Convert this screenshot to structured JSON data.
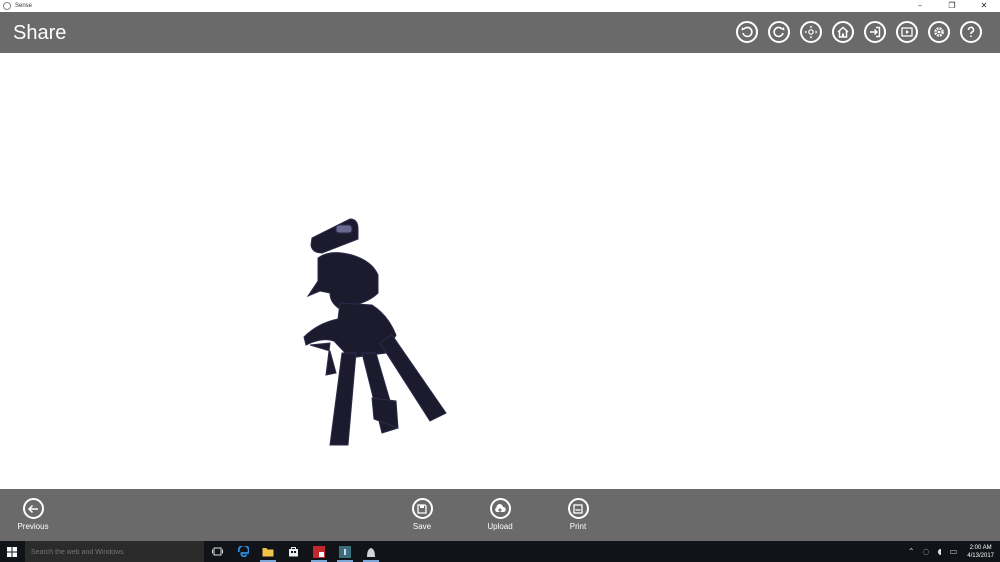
{
  "window": {
    "title": "Sense",
    "controls": [
      "–",
      "❐",
      "✕"
    ]
  },
  "header": {
    "title": "Share",
    "toolbar": [
      {
        "icon": "rotate-left-icon",
        "name": "undo-rotate-button"
      },
      {
        "icon": "rotate-right-icon",
        "name": "redo-rotate-button"
      },
      {
        "icon": "move-icon",
        "name": "move-button"
      },
      {
        "icon": "home-icon",
        "name": "home-button"
      },
      {
        "icon": "exit-icon",
        "name": "exit-button"
      },
      {
        "icon": "play-icon",
        "name": "play-button"
      },
      {
        "icon": "gear-icon",
        "name": "settings-button"
      },
      {
        "icon": "help-icon",
        "name": "help-button"
      }
    ]
  },
  "appbar": {
    "previous_label": "Previous",
    "save_label": "Save",
    "upload_label": "Upload",
    "print_label": "Print"
  },
  "taskbar": {
    "search_placeholder": "Search the web and Windows",
    "time": "2:00 AM",
    "date": "4/13/2017"
  },
  "colors": {
    "bar": "#6a6a6a",
    "taskbar": "#101418",
    "model": "#1c1b2e"
  }
}
